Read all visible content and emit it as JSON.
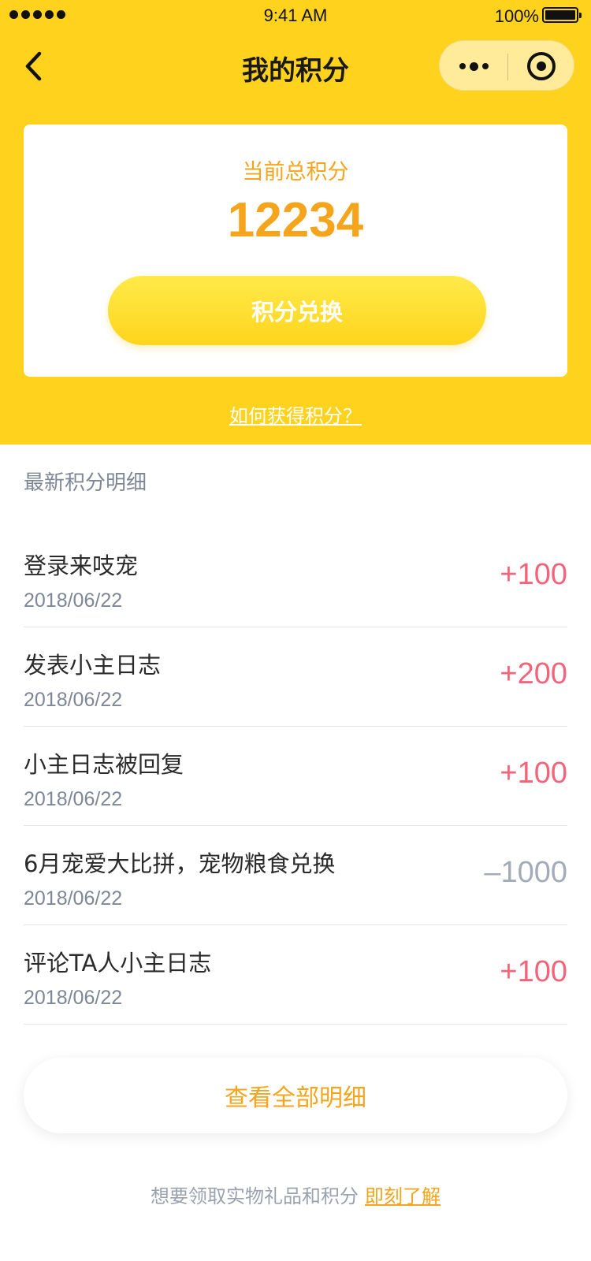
{
  "status_bar": {
    "time": "9:41 AM",
    "battery": "100%"
  },
  "nav": {
    "title": "我的积分"
  },
  "points": {
    "label": "当前总积分",
    "value": "12234",
    "redeem_label": "积分兑换",
    "how_link": "如何获得积分？"
  },
  "details": {
    "section_title": "最新积分明细",
    "items": [
      {
        "title": "登录来吱宠",
        "date": "2018/06/22",
        "amount": "+100"
      },
      {
        "title": "发表小主日志",
        "date": "2018/06/22",
        "amount": "+200"
      },
      {
        "title": "小主日志被回复",
        "date": "2018/06/22",
        "amount": "+100"
      },
      {
        "title": "6月宠爱大比拼，宠物粮食兑换",
        "date": "2018/06/22",
        "amount": "–1000"
      },
      {
        "title": "评论TA人小主日志",
        "date": "2018/06/22",
        "amount": "+100"
      }
    ],
    "view_all_label": "查看全部明细"
  },
  "footer": {
    "text": "想要领取实物礼品和积分",
    "link": "即刻了解"
  },
  "colors": {
    "header_bg": "#FFD21E",
    "accent": "#F5A41C",
    "positive": "#F2647A",
    "negative": "#A3ABB8"
  }
}
